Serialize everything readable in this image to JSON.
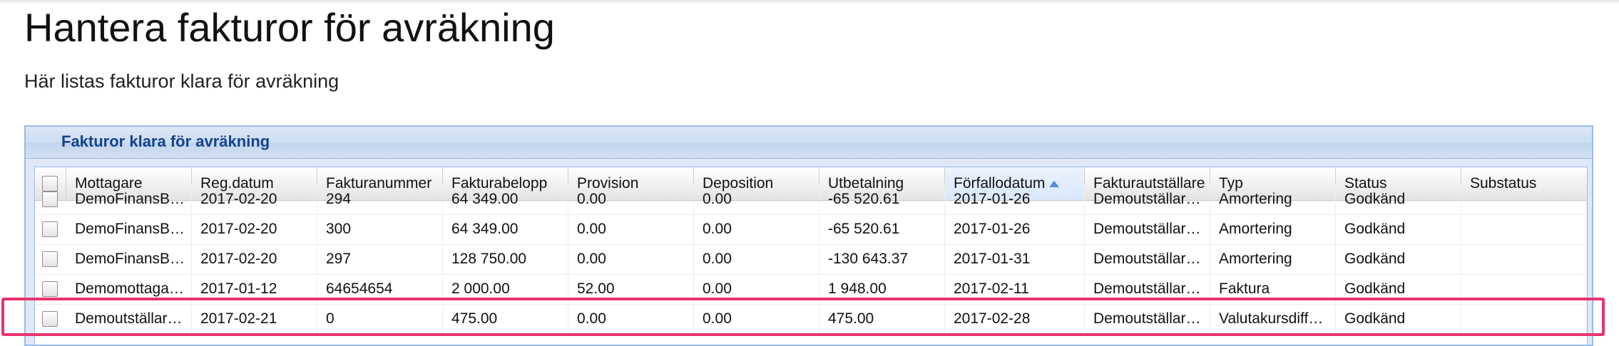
{
  "page": {
    "title": "Hantera fakturor för avräkning",
    "subtitle": "Här listas fakturor klara för avräkning"
  },
  "panel": {
    "title": "Fakturor klara för avräkning"
  },
  "grid": {
    "columns": [
      {
        "label": "Mottagare"
      },
      {
        "label": "Reg.datum"
      },
      {
        "label": "Fakturanummer"
      },
      {
        "label": "Fakturabelopp"
      },
      {
        "label": "Provision"
      },
      {
        "label": "Deposition"
      },
      {
        "label": "Utbetalning"
      },
      {
        "label": "Förfallodatum",
        "sorted": "asc"
      },
      {
        "label": "Fakturautställare"
      },
      {
        "label": "Typ"
      },
      {
        "label": "Status"
      },
      {
        "label": "Substatus"
      }
    ],
    "rows": [
      {
        "cells": [
          "DemoFinansB…",
          "2017-02-20",
          "294",
          "64 349.00",
          "0.00",
          "0.00",
          "-65 520.61",
          "2017-01-26",
          "Demoutställar…",
          "Amortering",
          "Godkänd",
          ""
        ]
      },
      {
        "cells": [
          "DemoFinansB…",
          "2017-02-20",
          "300",
          "64 349.00",
          "0.00",
          "0.00",
          "-65 520.61",
          "2017-01-26",
          "Demoutställar…",
          "Amortering",
          "Godkänd",
          ""
        ]
      },
      {
        "cells": [
          "DemoFinansB…",
          "2017-02-20",
          "297",
          "128 750.00",
          "0.00",
          "0.00",
          "-130 643.37",
          "2017-01-31",
          "Demoutställar…",
          "Amortering",
          "Godkänd",
          ""
        ]
      },
      {
        "cells": [
          "Demomottaga…",
          "2017-01-12",
          "64654654",
          "2 000.00",
          "52.00",
          "0.00",
          "1 948.00",
          "2017-02-11",
          "Demoutställar…",
          "Faktura",
          "Godkänd",
          ""
        ]
      },
      {
        "cells": [
          "Demoutställar…",
          "2017-02-21",
          "0",
          "475.00",
          "0.00",
          "0.00",
          "475.00",
          "2017-02-28",
          "Demoutställar…",
          "Valutakursdiff…",
          "Godkänd",
          ""
        ]
      }
    ]
  },
  "colors": {
    "highlight": "#e8336d",
    "panel_title": "#15428b",
    "panel_border": "#99bbe8"
  }
}
